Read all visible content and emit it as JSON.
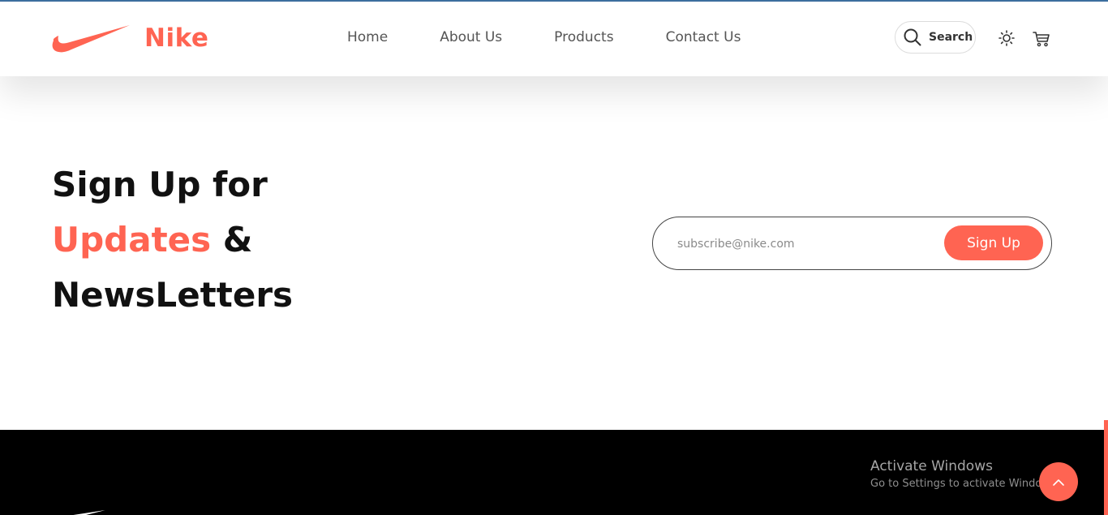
{
  "colors": {
    "accent": "#ff6452",
    "text_dark": "#111111",
    "nav_text": "#555555",
    "footer_bg": "#000000"
  },
  "brand": {
    "name": "Nike",
    "logo_icon": "swoosh-icon"
  },
  "nav": {
    "items": [
      "Home",
      "About Us",
      "Products",
      "Contact Us"
    ]
  },
  "header_actions": {
    "search_label": "Search",
    "search_icon": "search-icon",
    "theme_icon": "sun-icon",
    "cart_icon": "cart-icon"
  },
  "signup": {
    "line1": "Sign Up for",
    "line2_accent": "Updates",
    "line2_rest": " &",
    "line3": "NewsLetters",
    "email_value": "",
    "email_placeholder": "subscribe@nike.com",
    "button_label": "Sign Up"
  },
  "footer": {
    "logo_icon": "swoosh-icon"
  },
  "overlay": {
    "activate_title": "Activate Windows",
    "activate_subtitle": "Go to Settings to activate Windows.",
    "scroll_top_icon": "chevron-up-icon"
  }
}
